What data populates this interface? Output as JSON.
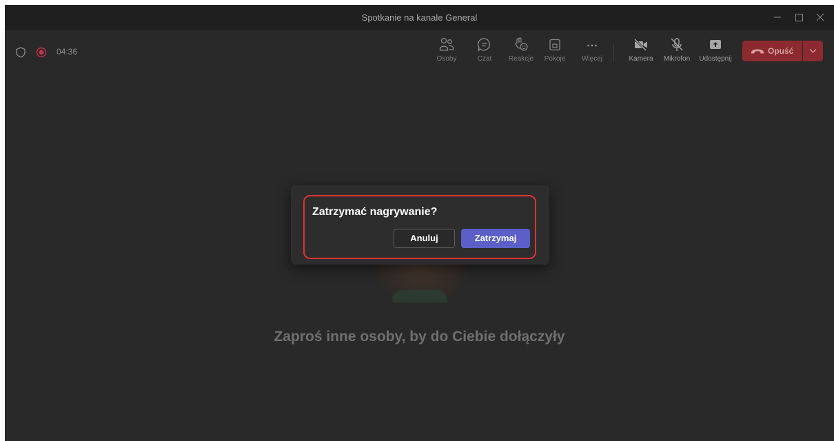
{
  "window": {
    "title": "Spotkanie na kanale General"
  },
  "status": {
    "timer": "04:36"
  },
  "toolbar": {
    "people": "Osoby",
    "chat": "Czat",
    "reactions": "Reakcje",
    "rooms": "Pokoje",
    "more": "Więcej",
    "camera": "Kamera",
    "microphone": "Mikrofon",
    "share": "Udostępnij",
    "leave": "Opuść"
  },
  "stage": {
    "invite_text": "Zaproś inne osoby, by do Ciebie dołączyły"
  },
  "dialog": {
    "title": "Zatrzymać nagrywanie?",
    "cancel_label": "Anuluj",
    "confirm_label": "Zatrzymaj"
  },
  "colors": {
    "app_background": "#292929",
    "titlebar": "#1f1f1f",
    "leave_button": "#8c2a30",
    "primary_button": "#5b5fc7",
    "highlight_outline": "#e23030",
    "recording_dot": "#c4314b"
  },
  "icons": {
    "shield": "shield-icon",
    "recording": "recording-icon",
    "people": "people-icon",
    "chat": "chat-icon",
    "reactions": "reactions-icon",
    "rooms": "rooms-icon",
    "more": "more-icon",
    "camera": "camera-off-icon",
    "microphone": "microphone-off-icon",
    "share": "share-icon",
    "leave": "phone-hangup-icon",
    "chevron": "chevron-down-icon"
  }
}
